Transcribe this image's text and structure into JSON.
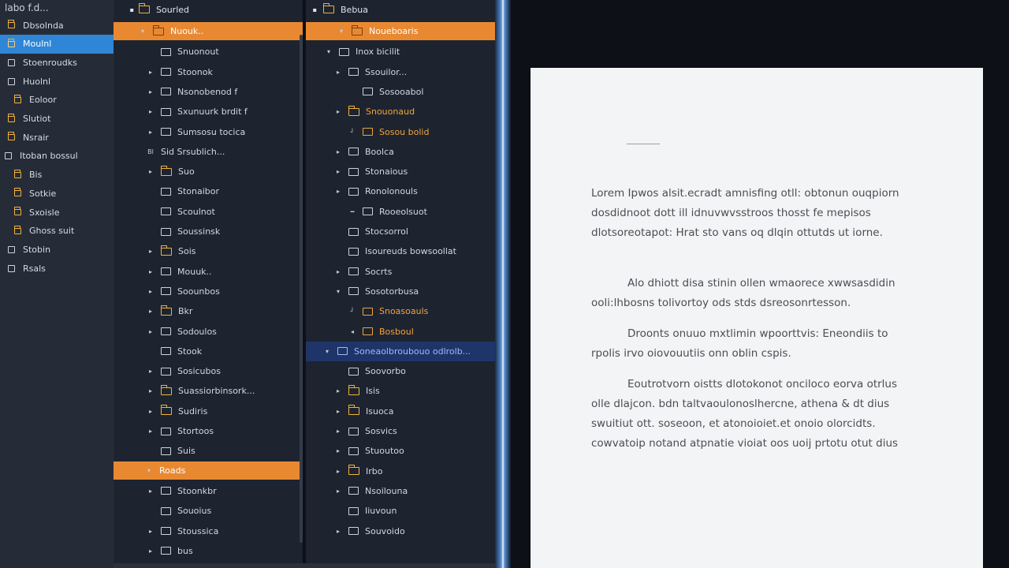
{
  "sidebar": {
    "title": "labo f.d...",
    "items": [
      {
        "label": "Dbsolnda",
        "icon": "folder-icon",
        "active": false
      },
      {
        "label": "Moulnl",
        "icon": "folder-icon",
        "active": true
      },
      {
        "label": "Stoenroudks",
        "icon": "box-icon",
        "active": false
      },
      {
        "label": "Huolnl",
        "icon": "box-icon",
        "active": false
      },
      {
        "label": "Eoloor",
        "icon": "folder-icon",
        "active": false
      },
      {
        "label": "Slutiot",
        "icon": "folder-icon",
        "active": false
      },
      {
        "label": "Nsrair",
        "icon": "folder-icon",
        "active": false
      },
      {
        "label": "Itoban bossul",
        "icon": "box-icon",
        "active": false
      },
      {
        "label": "Bis",
        "icon": "folder-icon",
        "active": false
      },
      {
        "label": "Sotkie",
        "icon": "folder-icon",
        "active": false
      },
      {
        "label": "Sxoisle",
        "icon": "folder-icon",
        "active": false
      },
      {
        "label": "Ghoss suit",
        "icon": "folder-icon",
        "active": false
      },
      {
        "label": "Stobin",
        "icon": "box-icon",
        "active": false
      },
      {
        "label": "Rsals",
        "icon": "box-icon",
        "active": false
      }
    ]
  },
  "panel1": {
    "header": "Sourled",
    "rows": [
      {
        "label": "Nuouk..",
        "icon": "folder",
        "arrow": "▾",
        "style": "orange"
      },
      {
        "label": "Snuonout",
        "icon": "box",
        "arrow": "",
        "style": ""
      },
      {
        "label": "Stoonok",
        "icon": "box",
        "arrow": "▸",
        "style": ""
      },
      {
        "label": "Nsonobenod f",
        "icon": "box",
        "arrow": "▸",
        "style": ""
      },
      {
        "label": "Sxunuurk brdit f",
        "icon": "box",
        "arrow": "▸",
        "style": ""
      },
      {
        "label": "Sumsosu tocica",
        "icon": "box",
        "arrow": "▸",
        "style": ""
      },
      {
        "label": "Sid Srsublich...",
        "icon": "none",
        "arrow": "Bl",
        "style": ""
      },
      {
        "label": "Suo",
        "icon": "folder",
        "arrow": "▸",
        "style": ""
      },
      {
        "label": "Stonaibor",
        "icon": "box",
        "arrow": "",
        "style": ""
      },
      {
        "label": "Scoulnot",
        "icon": "box",
        "arrow": "",
        "style": ""
      },
      {
        "label": "Soussinsk",
        "icon": "box",
        "arrow": "",
        "style": ""
      },
      {
        "label": "Sois",
        "icon": "folder",
        "arrow": "▸",
        "style": ""
      },
      {
        "label": "Mouuk..",
        "icon": "box",
        "arrow": "▸",
        "style": ""
      },
      {
        "label": "Soounbos",
        "icon": "box",
        "arrow": "▸",
        "style": ""
      },
      {
        "label": "Bkr",
        "icon": "folder",
        "arrow": "▸",
        "style": ""
      },
      {
        "label": "Sodoulos",
        "icon": "box",
        "arrow": "▸",
        "style": ""
      },
      {
        "label": "Stook",
        "icon": "box",
        "arrow": "",
        "style": ""
      },
      {
        "label": "Sosicubos",
        "icon": "box",
        "arrow": "▸",
        "style": ""
      },
      {
        "label": "Suassiorbinsork...",
        "icon": "folder",
        "arrow": "▸",
        "style": ""
      },
      {
        "label": "Sudiris",
        "icon": "folder",
        "arrow": "▸",
        "style": ""
      },
      {
        "label": "Stortoos",
        "icon": "box",
        "arrow": "▸",
        "style": ""
      },
      {
        "label": "Suis",
        "icon": "box",
        "arrow": "",
        "style": ""
      },
      {
        "label": "Roads",
        "icon": "none",
        "arrow": "▾",
        "style": "orange"
      },
      {
        "label": "Stoonkbr",
        "icon": "box",
        "arrow": "▸",
        "style": ""
      },
      {
        "label": "Souoius",
        "icon": "box",
        "arrow": "",
        "style": ""
      },
      {
        "label": "Stoussica",
        "icon": "box",
        "arrow": "▸",
        "style": ""
      },
      {
        "label": "bus",
        "icon": "box",
        "arrow": "▸",
        "style": ""
      }
    ]
  },
  "panel2": {
    "header": "Bebua",
    "rows": [
      {
        "label": "Noueboaris",
        "icon": "folder",
        "arrow": "▾",
        "style": "orange"
      },
      {
        "label": "Inox bicilit",
        "icon": "box",
        "arrow": "▾",
        "style": ""
      },
      {
        "label": "Ssouilor...",
        "icon": "box",
        "arrow": "▸",
        "style": ""
      },
      {
        "label": "Sosooabol",
        "icon": "box",
        "arrow": "",
        "style": ""
      },
      {
        "label": "Snouonaud",
        "icon": "folder",
        "arrow": "▸",
        "style": "folder-text"
      },
      {
        "label": "Sosou bolid",
        "icon": "box",
        "arrow": "┘",
        "style": "folder-text"
      },
      {
        "label": "Boolca",
        "icon": "box",
        "arrow": "▸",
        "style": ""
      },
      {
        "label": "Stonaious",
        "icon": "box",
        "arrow": "▸",
        "style": ""
      },
      {
        "label": "Ronolonouls",
        "icon": "box",
        "arrow": "▸",
        "style": ""
      },
      {
        "label": "Rooeolsuot",
        "icon": "box",
        "arrow": "━",
        "style": ""
      },
      {
        "label": "Stocsorrol",
        "icon": "box",
        "arrow": "",
        "style": ""
      },
      {
        "label": "Isoureuds bowsoollat",
        "icon": "box",
        "arrow": "",
        "style": ""
      },
      {
        "label": "Socrts",
        "icon": "box",
        "arrow": "▸",
        "style": ""
      },
      {
        "label": "Sosotorbusa",
        "icon": "box",
        "arrow": "▾",
        "style": ""
      },
      {
        "label": "Snoasoauls",
        "icon": "box",
        "arrow": "┘",
        "style": "folder-text"
      },
      {
        "label": "Bosboul",
        "icon": "box",
        "arrow": "◂",
        "style": "folder-text"
      },
      {
        "label": "Soneaolbroubouo odlrolb...",
        "icon": "box",
        "arrow": "▾",
        "style": "blue"
      },
      {
        "label": "Soovorbo",
        "icon": "box",
        "arrow": "",
        "style": ""
      },
      {
        "label": "Isis",
        "icon": "folder",
        "arrow": "▸",
        "style": ""
      },
      {
        "label": "Isuoca",
        "icon": "folder",
        "arrow": "▸",
        "style": ""
      },
      {
        "label": "Sosvics",
        "icon": "box",
        "arrow": "▸",
        "style": ""
      },
      {
        "label": "Stuoutoo",
        "icon": "box",
        "arrow": "▸",
        "style": ""
      },
      {
        "label": "Irbo",
        "icon": "folder",
        "arrow": "▸",
        "style": ""
      },
      {
        "label": "Nsoilouna",
        "icon": "box",
        "arrow": "▸",
        "style": ""
      },
      {
        "label": "Iiuvoun",
        "icon": "box",
        "arrow": "",
        "style": ""
      },
      {
        "label": "Souvoido",
        "icon": "box",
        "arrow": "▸",
        "style": ""
      }
    ]
  },
  "document": {
    "paragraphs": [
      "Lorem Ipwos alsit.ecradt amnisfing otll: obtonun ouqpiorn dosdidnoot dott ill idnuvwvsstroos thosst fe mepisos dlotsoreotapot: Hrat sto vans oq dlqin ottutds ut iorne.",
      "Alo dhiott disa stinin ollen wmaorece xwwsasdidin ooli:lhbosns tolivortoy ods stds dsreosonrtesson.",
      "Droonts onuuo mxtlimin wpoorttvis: Eneondiis to rpolis irvo oiovouutiis onn oblin cspis.",
      "Eoutrotvorn oistts dlotokonot onciloco eorva otrlus olle dlajcon. bdn taltvaoulonoslhercne, athena & dt dius swuitiut ott. soseoon, et atonoioiet.et onoio olorcidts. cowvatoip notand atpnatie vioiat oos uoij prtotu otut dius"
    ]
  },
  "colors": {
    "accent_orange": "#e88932",
    "accent_blue": "#2f86d6",
    "selection_blue": "#1f3569"
  }
}
